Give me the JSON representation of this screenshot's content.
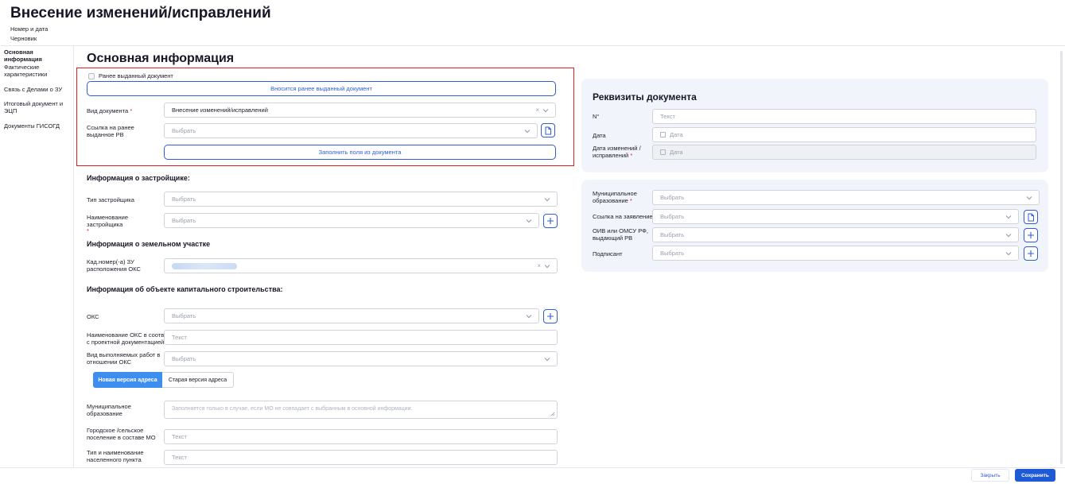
{
  "header": {
    "title": "Внесение изменений/исправлений",
    "number_date": "Номер и дата",
    "status": "Черновик"
  },
  "sidebar": {
    "items": [
      {
        "label": "Основная информация"
      },
      {
        "label": "Фактические характеристики"
      },
      {
        "label": "Связь с Делами о ЗУ"
      },
      {
        "label": "Итоговый документ и ЭЦП"
      },
      {
        "label": "Документы ГИСОГД"
      }
    ]
  },
  "main": {
    "title": "Основная информация",
    "prev_doc_checkbox": "Ранее выданный документ",
    "prev_doc_button": "Вносится ранее выданный документ",
    "doc_type": {
      "label": "Вид документа",
      "required": "*",
      "value": "Внесение изменений/исправлений"
    },
    "prev_rv_link": {
      "label": "Ссылка на ранее выданное РВ",
      "placeholder": "Выбрать"
    },
    "fill_from_doc_button": "Заполнить поля из документа",
    "developer_section": "Информация о застройщике:",
    "developer_type": {
      "label": "Тип застройщика",
      "placeholder": "Выбрать"
    },
    "developer_name": {
      "label": "Наименование застройщика",
      "required": "*",
      "placeholder": "Выбрать"
    },
    "land_section": "Информация о земельном участке",
    "cadastral": {
      "label": "Кад.номер(-а) ЗУ расположения ОКС"
    },
    "oks_section": "Информация об объекте капитального строительства:",
    "oks": {
      "label": "ОКС",
      "placeholder": "Выбрать"
    },
    "oks_name": {
      "label": "Наименование ОКС в соотв. с проектной документацией",
      "placeholder": "Текст"
    },
    "work_type": {
      "label": "Вид выполняемых работ в отношении ОКС",
      "placeholder": "Выбрать"
    },
    "address_tabs": {
      "new": "Новая версия адреса",
      "old": "Старая версия адреса"
    },
    "municipal": {
      "label": "Муниципальное образование",
      "placeholder": "Заполняется только в случае, если МО не совпадает с выбранным в основной информации."
    },
    "settlement": {
      "label": "Городское /сельское поселение в составе МО",
      "placeholder": "Текст"
    },
    "locality": {
      "label": "Тип и наименование населенного пункта",
      "placeholder": "Текст"
    }
  },
  "requisites": {
    "title": "Реквизиты документа",
    "number": {
      "label": "N°",
      "placeholder": "Текст"
    },
    "date": {
      "label": "Дата",
      "placeholder": "Дата"
    },
    "change_date": {
      "label": "Дата изменений / исправлений",
      "required": "*",
      "placeholder": "Дата"
    }
  },
  "details": {
    "municipal": {
      "label": "Муниципальное образование",
      "required": "*",
      "placeholder": "Выбрать"
    },
    "application_link": {
      "label": "Ссылка на заявление",
      "placeholder": "Выбрать"
    },
    "oiv": {
      "label": "ОИВ или ОМСУ РФ, выдающий РВ",
      "placeholder": "Выбрать"
    },
    "signer": {
      "label": "Подписант",
      "placeholder": "Выбрать"
    }
  },
  "footer": {
    "close": "Закрыть",
    "save": "Сохранить"
  }
}
